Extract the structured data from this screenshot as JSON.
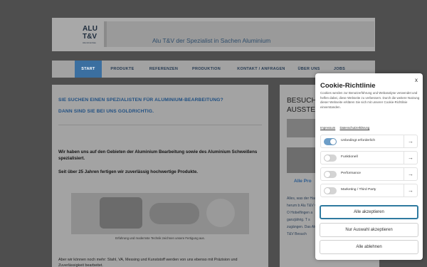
{
  "header": {
    "logo_line1": "ALU",
    "logo_line2": "T&V",
    "logo_sub": "Aluminiumbau",
    "tagline": "Alu T&V der Spezialist in Sachen Aluminium"
  },
  "nav": {
    "items": [
      {
        "label": "START",
        "active": true
      },
      {
        "label": "PRODUKTE",
        "active": false
      },
      {
        "label": "REFERENZEN",
        "active": false
      },
      {
        "label": "PRODUKTION",
        "active": false
      },
      {
        "label": "KONTAKT / ANFRAGEN",
        "active": false
      },
      {
        "label": "ÜBER UNS",
        "active": false
      },
      {
        "label": "JOBS",
        "active": false
      }
    ]
  },
  "main": {
    "headline1": "SIE SUCHEN EINEN SPEZIALISTEN FÜR ALUMINIUM-BEARBEITUNG?",
    "headline2": "DANN SIND SIE BEI UNS GOLDRICHTIG.",
    "para1": "Wir haben uns auf den Gebieten der Aluminium Bearbeitung sowie des Aluminium Schweißens spezialisiert.",
    "para2": "Seit über 25 Jahren fertigen wir zuverlässig hochwertige Produkte.",
    "image_caption": "Erfahrung und modernste Technik zeichnen unsere Fertigung aus.",
    "body_text": "Aber wir können noch mehr: Stahl, VA, Messing und Kunststoff werden von uns ebenso mit Präzision und Zuverlässigkeit bearbeitet."
  },
  "side": {
    "title_line1": "BESUCH",
    "title_line2": "AUSSTEL",
    "link": "Alle Pro",
    "text": "Alles, was der Haus herum b Alu T&V vor O Hobelfingen a ganzjährig. T s zugängen. Das Alu T&V Besuch"
  },
  "cookie": {
    "close": "x",
    "title": "Cookie-Richtlinie",
    "description": "Cookies werden zur Benutzerführung und Webanalyse verwendet und helfen dabei, diese Webseite zu verbessern. Durch die weitere Nutzung dieser Webseite erklären Sie sich mit unserer Cookie-Richtlinie einverstanden.",
    "link_imprint": "Impressum",
    "link_privacy": "Datenschutzerklärung",
    "categories": [
      {
        "label": "Unbedingt erforderlich",
        "enabled": true
      },
      {
        "label": "Funktionell",
        "enabled": false
      },
      {
        "label": "Performance",
        "enabled": false
      },
      {
        "label": "Marketing / Third Party",
        "enabled": false
      }
    ],
    "btn_accept_all": "Alle akzeptieren",
    "btn_accept_selection": "Nur Auswahl akzeptieren",
    "btn_reject_all": "Alle ablehnen",
    "colors": {
      "accent": "#2f7aa0",
      "toggle_on": "#6d9ec8"
    }
  }
}
